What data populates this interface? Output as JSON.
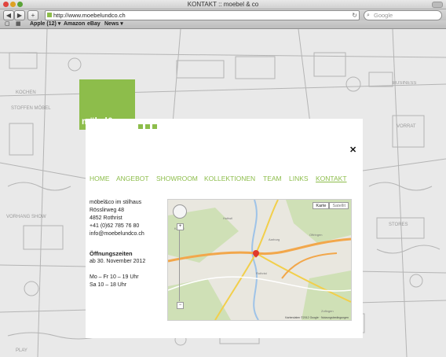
{
  "browser": {
    "window_title": "KONTAKT :: moebel & co",
    "url": "http://www.moebelundco.ch",
    "search_placeholder": "Google",
    "back_label": "◀",
    "forward_label": "▶",
    "add_label": "+",
    "bookmarks": [
      "Apple (12) ▾",
      "Amazon",
      "eBay",
      "News ▾"
    ]
  },
  "site": {
    "logo": "möbel&co",
    "close_label": "✕",
    "nav": [
      {
        "label": "HOME"
      },
      {
        "label": "ANGEBOT"
      },
      {
        "label": "SHOWROOM"
      },
      {
        "label": "KOLLEKTIONEN"
      },
      {
        "label": "TEAM"
      },
      {
        "label": "LINKS"
      },
      {
        "label": "KONTAKT",
        "active": true
      }
    ],
    "address": [
      "möbel&co im stilhaus",
      "Rösslirweg 48",
      "4852 Rothrist",
      "+41 (0)62 785 76 80",
      "info@moebelundco.ch"
    ],
    "hours_title": "Öffnungszeiten",
    "hours_date": "ab 30. November 2012",
    "hours": [
      "Mo – Fr 10 – 19 Uhr",
      "Sa 10 – 18 Uhr"
    ]
  },
  "map": {
    "tab_map": "Karte",
    "tab_satellite": "Satellit",
    "attribution": "Kartendaten ©2012 Google · Nutzungsbedingungen",
    "labels": [
      "Hottwil",
      "Aarburg",
      "Oftringen",
      "Rothrist",
      "Zofingen",
      "Kappel"
    ]
  },
  "colors": {
    "accent": "#8dbd4b",
    "background": "#e9e9e9",
    "panel": "#ffffff"
  }
}
